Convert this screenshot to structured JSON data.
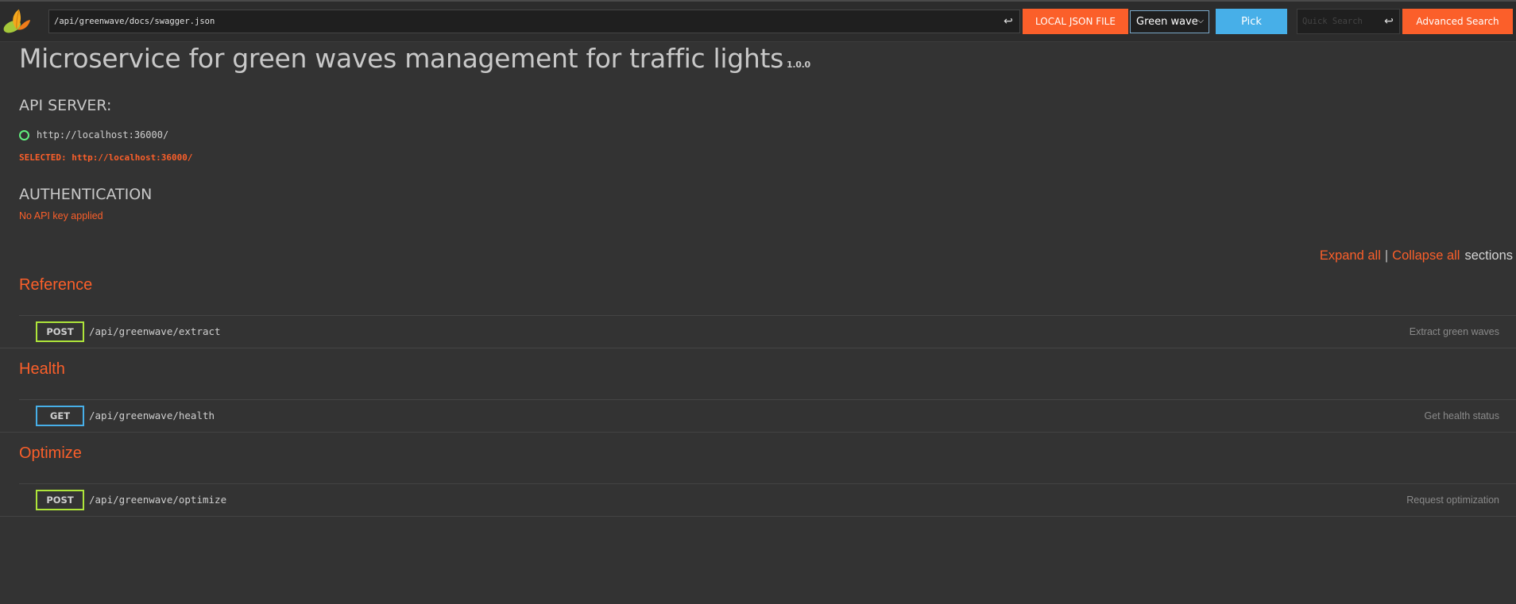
{
  "header": {
    "spec_url": "/api/greenwave/docs/swagger.json",
    "local_json_label": "LOCAL JSON FILE",
    "selected_spec": "Green wave",
    "pick_label": "Pick",
    "quick_search_placeholder": "Quick Search",
    "advanced_search_label": "Advanced Search",
    "enter_glyph": "↩"
  },
  "info": {
    "title": "Microservice for green waves management for traffic lights",
    "version": "1.0.0"
  },
  "api_server": {
    "heading": "API SERVER:",
    "servers": [
      "http://localhost:36000/"
    ],
    "selected_label": "SELECTED: http://localhost:36000/"
  },
  "authentication": {
    "heading": "AUTHENTICATION",
    "status": "No API key applied"
  },
  "expand_controls": {
    "expand_all": "Expand all",
    "separator": "|",
    "collapse_all": "Collapse all",
    "suffix": "sections"
  },
  "tags": [
    {
      "name": "Reference",
      "operations": [
        {
          "method": "POST",
          "path": "/api/greenwave/extract",
          "summary": "Extract green waves"
        }
      ]
    },
    {
      "name": "Health",
      "operations": [
        {
          "method": "GET",
          "path": "/api/greenwave/health",
          "summary": "Get health status"
        }
      ]
    },
    {
      "name": "Optimize",
      "operations": [
        {
          "method": "POST",
          "path": "/api/greenwave/optimize",
          "summary": "Request optimization"
        }
      ]
    }
  ],
  "colors": {
    "background": "#333333",
    "accent_orange": "#fb5f2a",
    "pick_blue": "#47afe8",
    "post_green": "#aee53a",
    "get_blue": "#47afe8",
    "radio_green": "#62f07f"
  }
}
